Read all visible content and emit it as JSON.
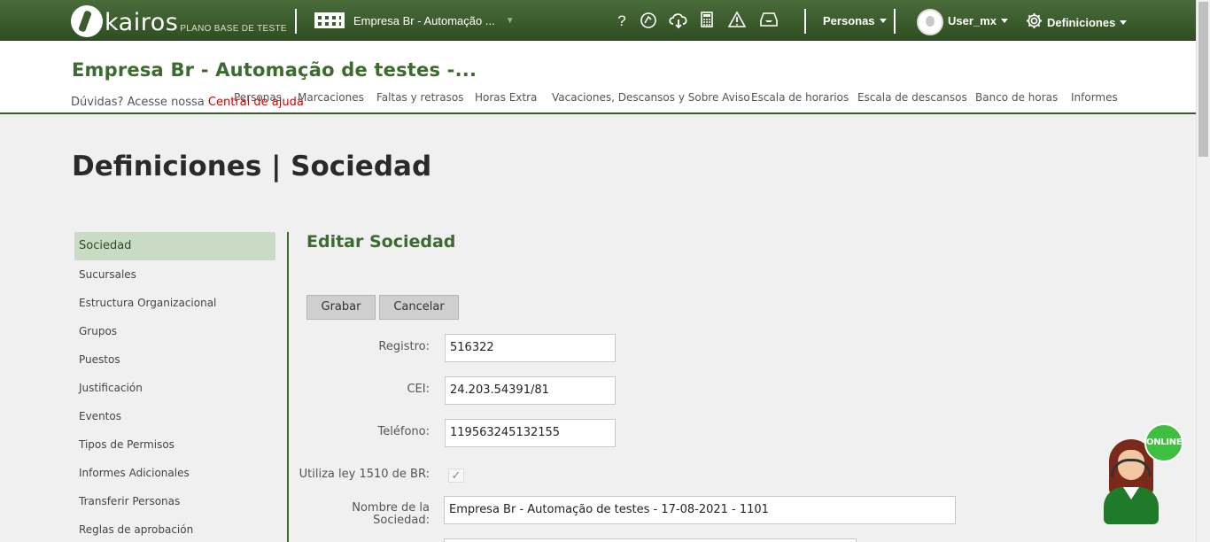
{
  "topbar": {
    "logo_word": "kairos",
    "logo_sub": "PLANO BASE DE TESTE",
    "company_selector": "Empresa Br - Automação ...",
    "icons": [
      "help-icon",
      "support-icon",
      "cloud-download-icon",
      "calculator-icon",
      "warning-icon",
      "inbox-icon"
    ],
    "help_glyph": "?",
    "personas_menu": "Personas",
    "user_menu": "User_mx",
    "settings_menu": "Definiciones"
  },
  "header": {
    "company_title": "Empresa Br - Automação de testes -...",
    "help_prefix": "Dúvidas? Acesse nossa ",
    "help_link": "Central de ajuda",
    "nav": [
      "Personas",
      "Marcaciones",
      "Faltas y retrasos",
      "Horas Extra",
      "Vacaciones, Descansos y Sobre Aviso",
      "Escala de horarios",
      "Escala de descansos",
      "Banco de horas",
      "Informes"
    ]
  },
  "page": {
    "title": "Definiciones | Sociedad"
  },
  "sidebar": {
    "items": [
      "Sociedad",
      "Sucursales",
      "Estructura Organizacional",
      "Grupos",
      "Puestos",
      "Justificación",
      "Eventos",
      "Tipos de Permisos",
      "Informes Adicionales",
      "Transferir Personas",
      "Reglas de aprobación"
    ],
    "active": "Sociedad"
  },
  "form": {
    "section_title": "Editar Sociedad",
    "save_label": "Grabar",
    "cancel_label": "Cancelar",
    "registro_label": "Registro:",
    "registro_value": "516322",
    "cei_label": "CEI:",
    "cei_value": "24.203.54391/81",
    "telefono_label": "Teléfono:",
    "telefono_value": "119563245132155",
    "ley_label": "Utiliza ley 1510 de BR:",
    "ley_checked": true,
    "nombre_label_1": "Nombre de la",
    "nombre_label_2": "Sociedad:",
    "nombre_value": "Empresa Br  - Automação de testes - 17-08-2021 - 1101"
  },
  "chat_widget": {
    "status": "ONLINE",
    "colors": {
      "status": "#3fbf3f",
      "uniform": "#1f7a2a"
    }
  },
  "colors": {
    "brand_green": "#3b6b2e",
    "topbar": "#3b5c2c",
    "help_link": "#d00000",
    "active_item_bg": "#c9dbc4"
  }
}
